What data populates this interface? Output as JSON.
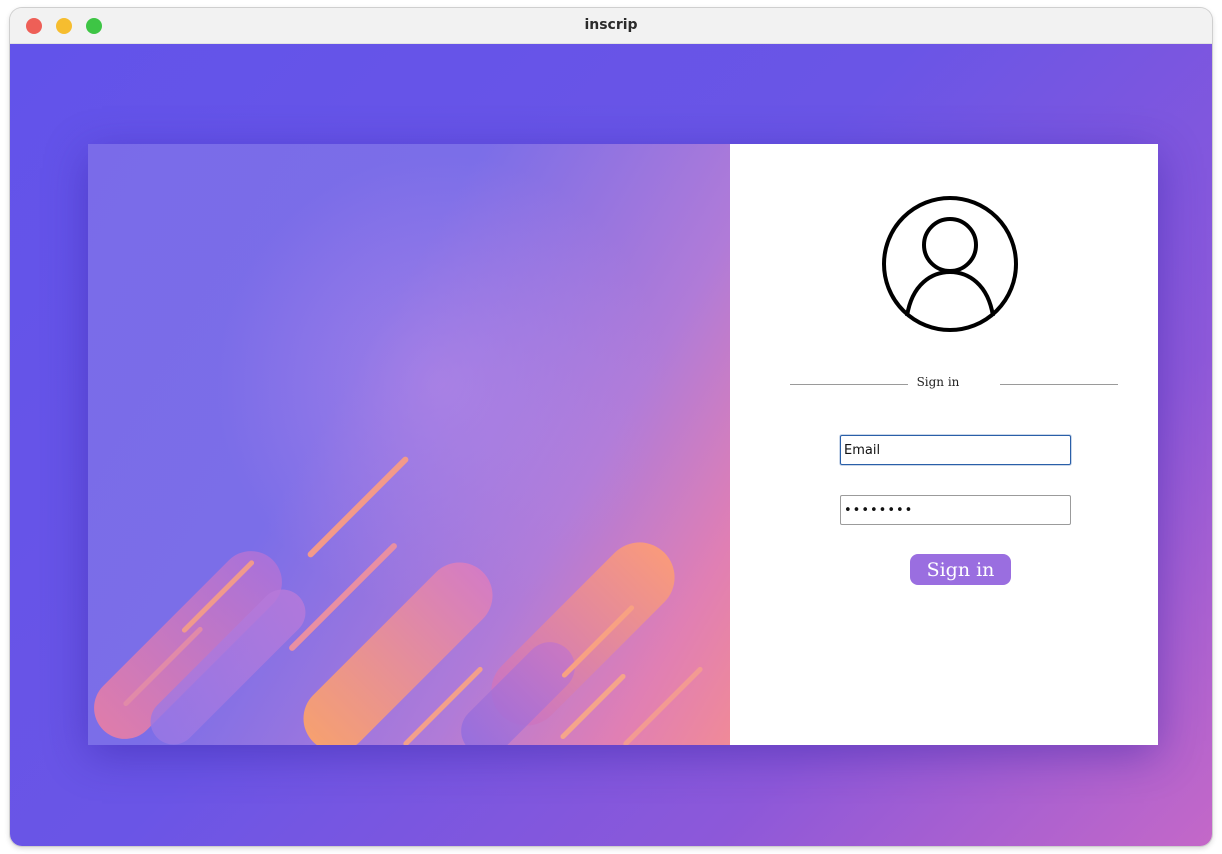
{
  "window": {
    "title": "inscrip"
  },
  "login": {
    "divider_text": "Sign in",
    "email_value": "Email",
    "password_value": "••••••••",
    "submit_label": "Sign in"
  },
  "icons": {
    "avatar": "user-circle-icon"
  },
  "colors": {
    "background_start": "#6253ea",
    "background_end": "#c468c8",
    "button": "#9a6ee0",
    "input_focus": "#2a5fa8"
  }
}
